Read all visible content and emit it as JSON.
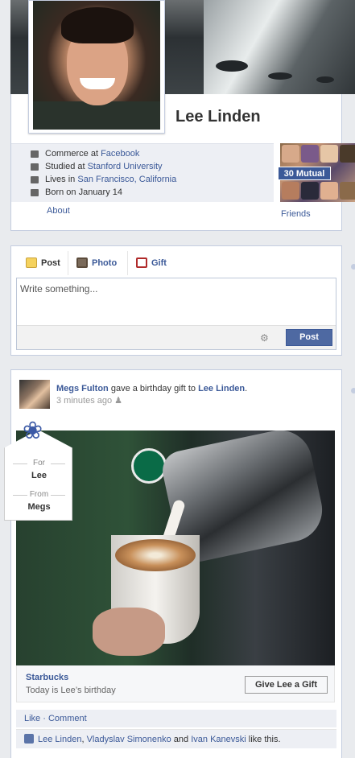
{
  "profile": {
    "name": "Lee Linden",
    "info": [
      {
        "icon": "briefcase-icon",
        "prefix": "Commerce at ",
        "link": "Facebook"
      },
      {
        "icon": "graduation-cap-icon",
        "prefix": "Studied at ",
        "link": "Stanford University"
      },
      {
        "icon": "house-icon",
        "prefix": "Lives in ",
        "link": "San Francisco, California"
      },
      {
        "icon": "calendar-icon",
        "prefix": "Born on January 14",
        "link": ""
      }
    ],
    "about_label": "About",
    "mutual_label": "30 Mutual",
    "friends_label": "Friends"
  },
  "composer": {
    "tabs": [
      {
        "label": "Post",
        "icon": "note-icon"
      },
      {
        "label": "Photo",
        "icon": "photo-icon"
      },
      {
        "label": "Gift",
        "icon": "gift-icon"
      }
    ],
    "placeholder": "Write something...",
    "post_button": "Post"
  },
  "story": {
    "actor": "Megs Fulton",
    "verb": " gave a birthday gift to ",
    "target": "Lee Linden",
    "period": ".",
    "time": "3 minutes ago",
    "tag": {
      "for_label": "For",
      "for_value": "Lee",
      "from_label": "From",
      "from_value": "Megs"
    },
    "attachment": {
      "title": "Starbucks",
      "subtitle": "Today is Lee’s birthday",
      "button": "Give Lee a Gift"
    },
    "actions": {
      "like": "Like",
      "sep": " · ",
      "comment": "Comment"
    },
    "likers": {
      "names": [
        "Lee Linden",
        "Vladyslav Simonenko",
        "Ivan Kanevski"
      ],
      "sep1": ", ",
      "and": " and ",
      "suffix": " like this."
    }
  },
  "colors": {
    "link": "#3b5998",
    "button": "#4e69a2",
    "panel": "#edeff4"
  }
}
